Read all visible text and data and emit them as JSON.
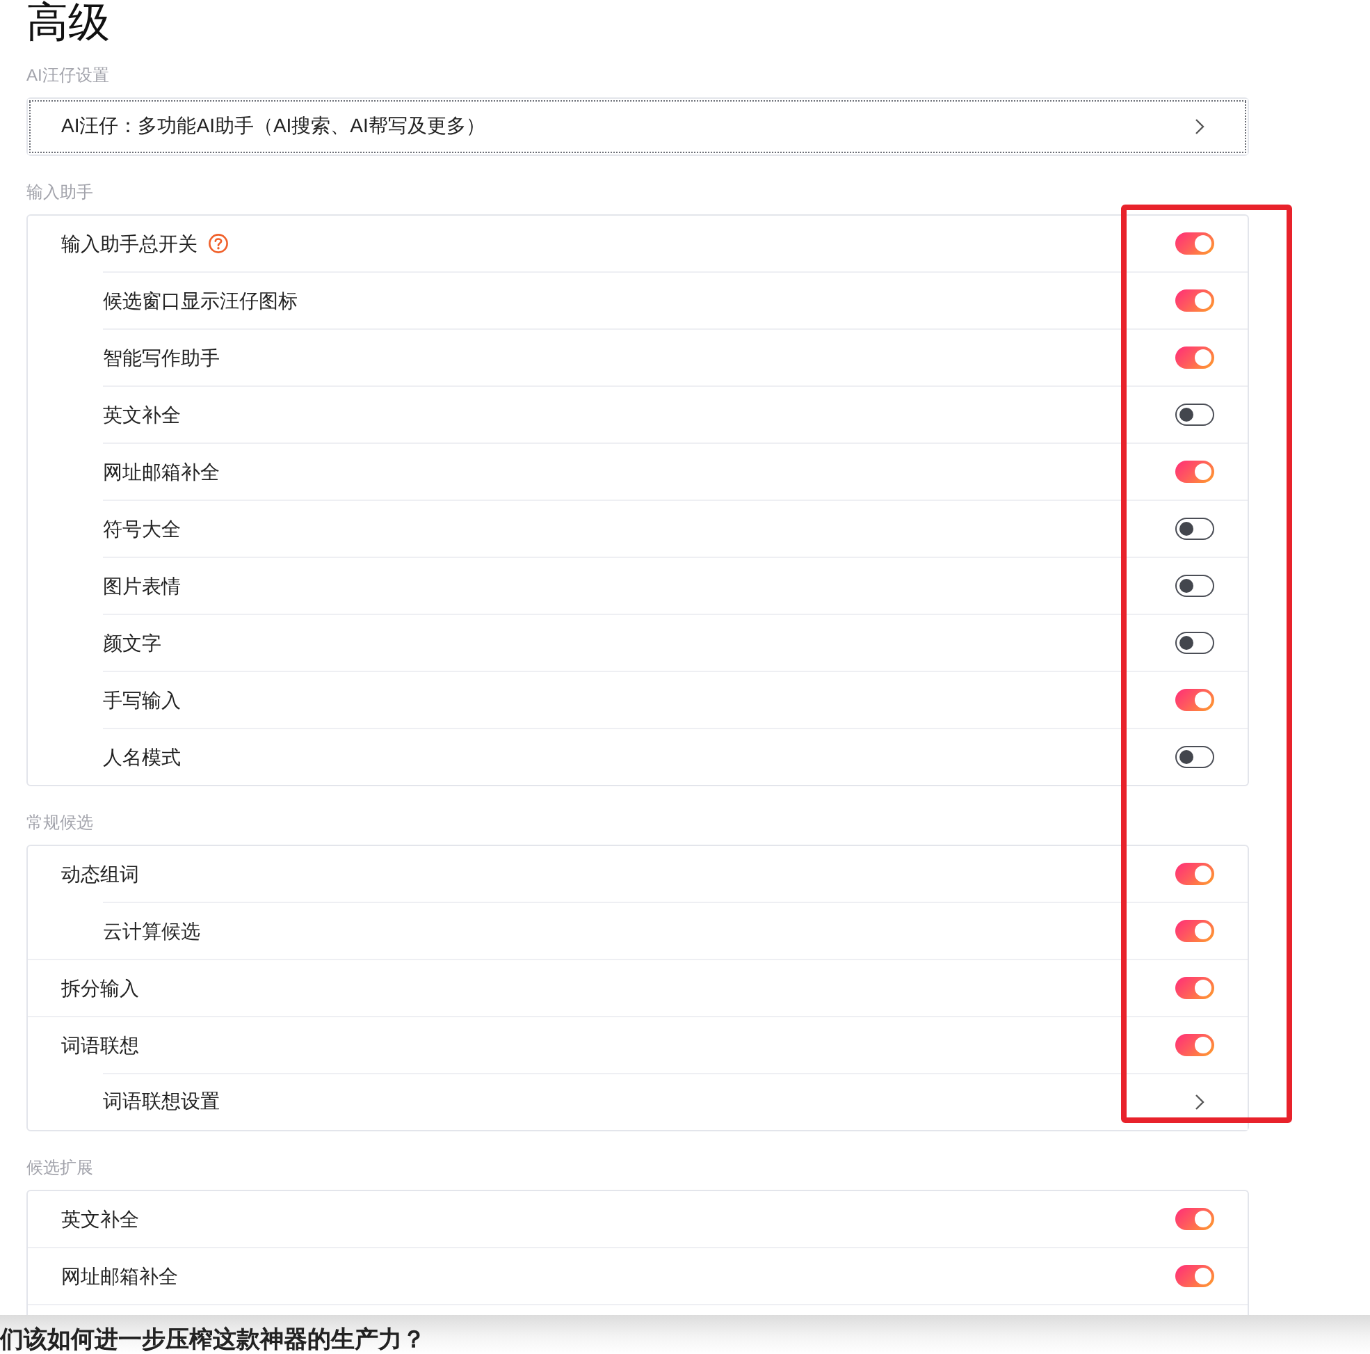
{
  "title": "高级",
  "sections": [
    {
      "heading": "AI汪仔设置",
      "rows": [
        {
          "kind": "link",
          "label": "AI汪仔：多功能AI助手（AI搜索、AI帮写及更多）",
          "focused": true
        }
      ]
    },
    {
      "heading": "输入助手",
      "rows": [
        {
          "kind": "toggle",
          "label": "输入助手总开关",
          "on": true,
          "help_icon": true,
          "children": [
            {
              "kind": "toggle",
              "label": "候选窗口显示汪仔图标",
              "on": true
            },
            {
              "kind": "toggle",
              "label": "智能写作助手",
              "on": true
            },
            {
              "kind": "toggle",
              "label": "英文补全",
              "on": false
            },
            {
              "kind": "toggle",
              "label": "网址邮箱补全",
              "on": true
            },
            {
              "kind": "toggle",
              "label": "符号大全",
              "on": false
            },
            {
              "kind": "toggle",
              "label": "图片表情",
              "on": false
            },
            {
              "kind": "toggle",
              "label": "颜文字",
              "on": false
            },
            {
              "kind": "toggle",
              "label": "手写输入",
              "on": true
            },
            {
              "kind": "toggle",
              "label": "人名模式",
              "on": false
            }
          ]
        }
      ]
    },
    {
      "heading": "常规候选",
      "rows": [
        {
          "kind": "toggle",
          "label": "动态组词",
          "on": true,
          "children": [
            {
              "kind": "toggle",
              "label": "云计算候选",
              "on": true
            }
          ]
        },
        {
          "kind": "toggle",
          "label": "拆分输入",
          "on": true
        },
        {
          "kind": "toggle",
          "label": "词语联想",
          "on": true,
          "children": [
            {
              "kind": "link",
              "label": "词语联想设置",
              "focused": false
            }
          ]
        }
      ]
    },
    {
      "heading": "候选扩展",
      "cut_off": true,
      "rows": [
        {
          "kind": "toggle",
          "label": "英文补全",
          "on": true
        },
        {
          "kind": "toggle",
          "label": "网址邮箱补全",
          "on": true
        }
      ]
    }
  ],
  "highlight_frame": true,
  "article_heading": "们该如何进一步压榨这款神器的生产力？"
}
